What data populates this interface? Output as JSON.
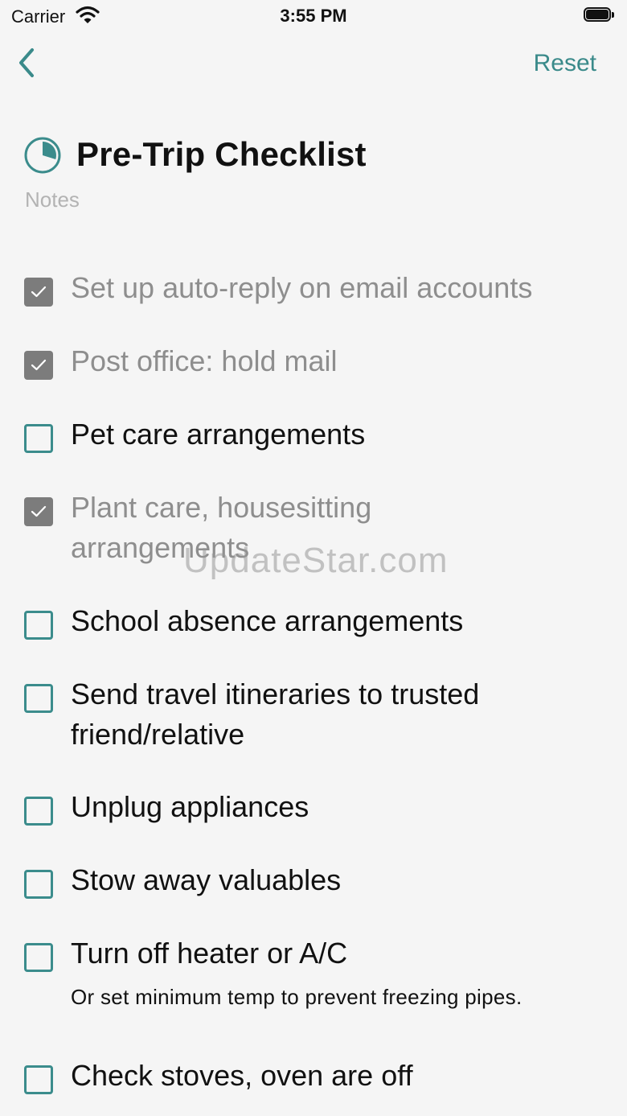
{
  "status": {
    "carrier": "Carrier",
    "time": "3:55 PM"
  },
  "nav": {
    "reset": "Reset"
  },
  "title": "Pre-Trip Checklist",
  "notes_placeholder": "Notes",
  "items": [
    {
      "label": "Set up auto-reply on email accounts",
      "checked": true
    },
    {
      "label": "Post office: hold mail",
      "checked": true
    },
    {
      "label": "Pet care arrangements",
      "checked": false
    },
    {
      "label": "Plant care, housesitting arrangements",
      "checked": true
    },
    {
      "label": "School absence arrangements",
      "checked": false
    },
    {
      "label": "Send travel itineraries to trusted friend/relative",
      "checked": false
    },
    {
      "label": "Unplug appliances",
      "checked": false
    },
    {
      "label": "Stow away valuables",
      "checked": false
    },
    {
      "label": "Turn off heater or A/C",
      "checked": false,
      "note": "Or set minimum temp to prevent freezing pipes."
    },
    {
      "label": "Check stoves, oven are off",
      "checked": false
    }
  ],
  "watermark": "UpdateStar.com",
  "colors": {
    "accent": "#3b8c8c",
    "checked_box": "#7c7c7c",
    "done_text": "#8e8e8e"
  }
}
